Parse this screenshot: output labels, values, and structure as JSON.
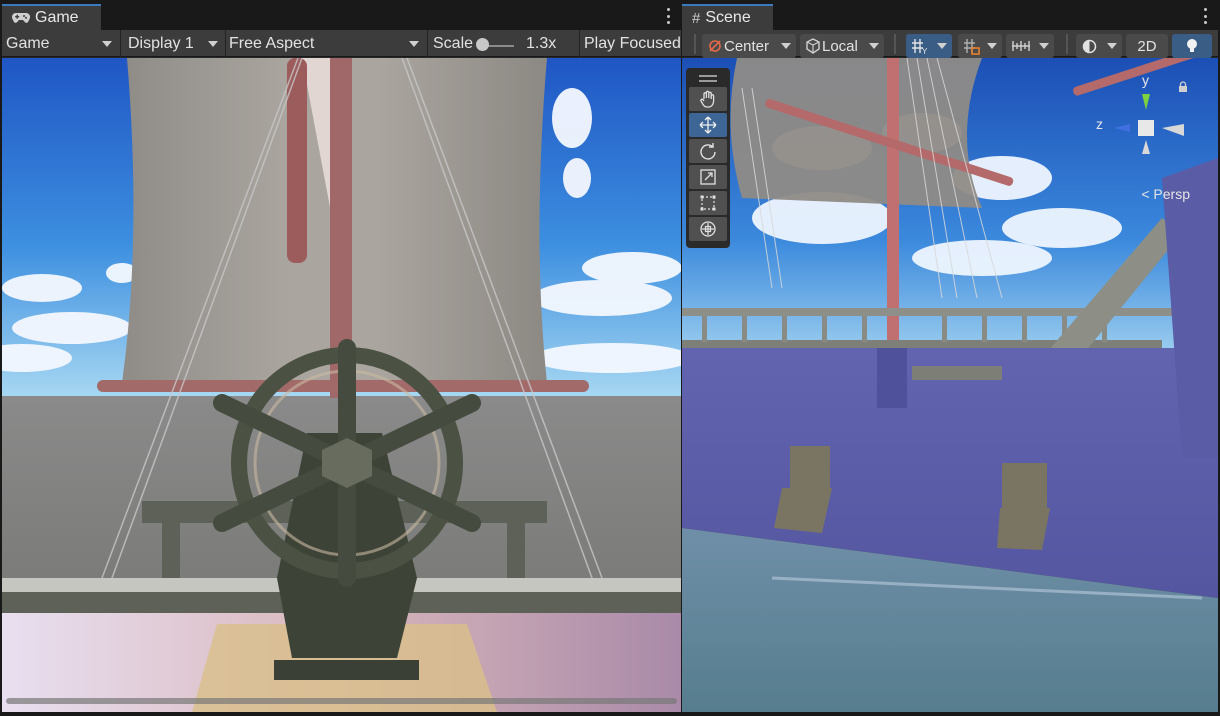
{
  "game": {
    "tab_label": "Game",
    "tab_icon": "gamepad-icon",
    "toolbar": {
      "mode": "Game",
      "display": "Display 1",
      "aspect": "Free Aspect",
      "scale_label": "Scale",
      "scale_value": "1.3x",
      "play_mode": "Play Focused"
    }
  },
  "scene": {
    "tab_label": "Scene",
    "tab_icon": "grid-hash-icon",
    "toolbar": {
      "pivot": "Center",
      "handle_rotation": "Local",
      "mode_2d": "2D"
    },
    "tools": [
      "hand-tool-icon",
      "move-tool-icon",
      "rotate-tool-icon",
      "scale-tool-icon",
      "rect-tool-icon",
      "transform-tool-icon"
    ],
    "active_tool": "move-tool-icon",
    "gizmo": {
      "y_label": "y",
      "z_label": "z",
      "projection": "Persp"
    }
  },
  "colors": {
    "accent": "#3a79bb",
    "active_button": "#3a5d86",
    "panel": "#282828",
    "toolbar": "#3c3c3c"
  }
}
